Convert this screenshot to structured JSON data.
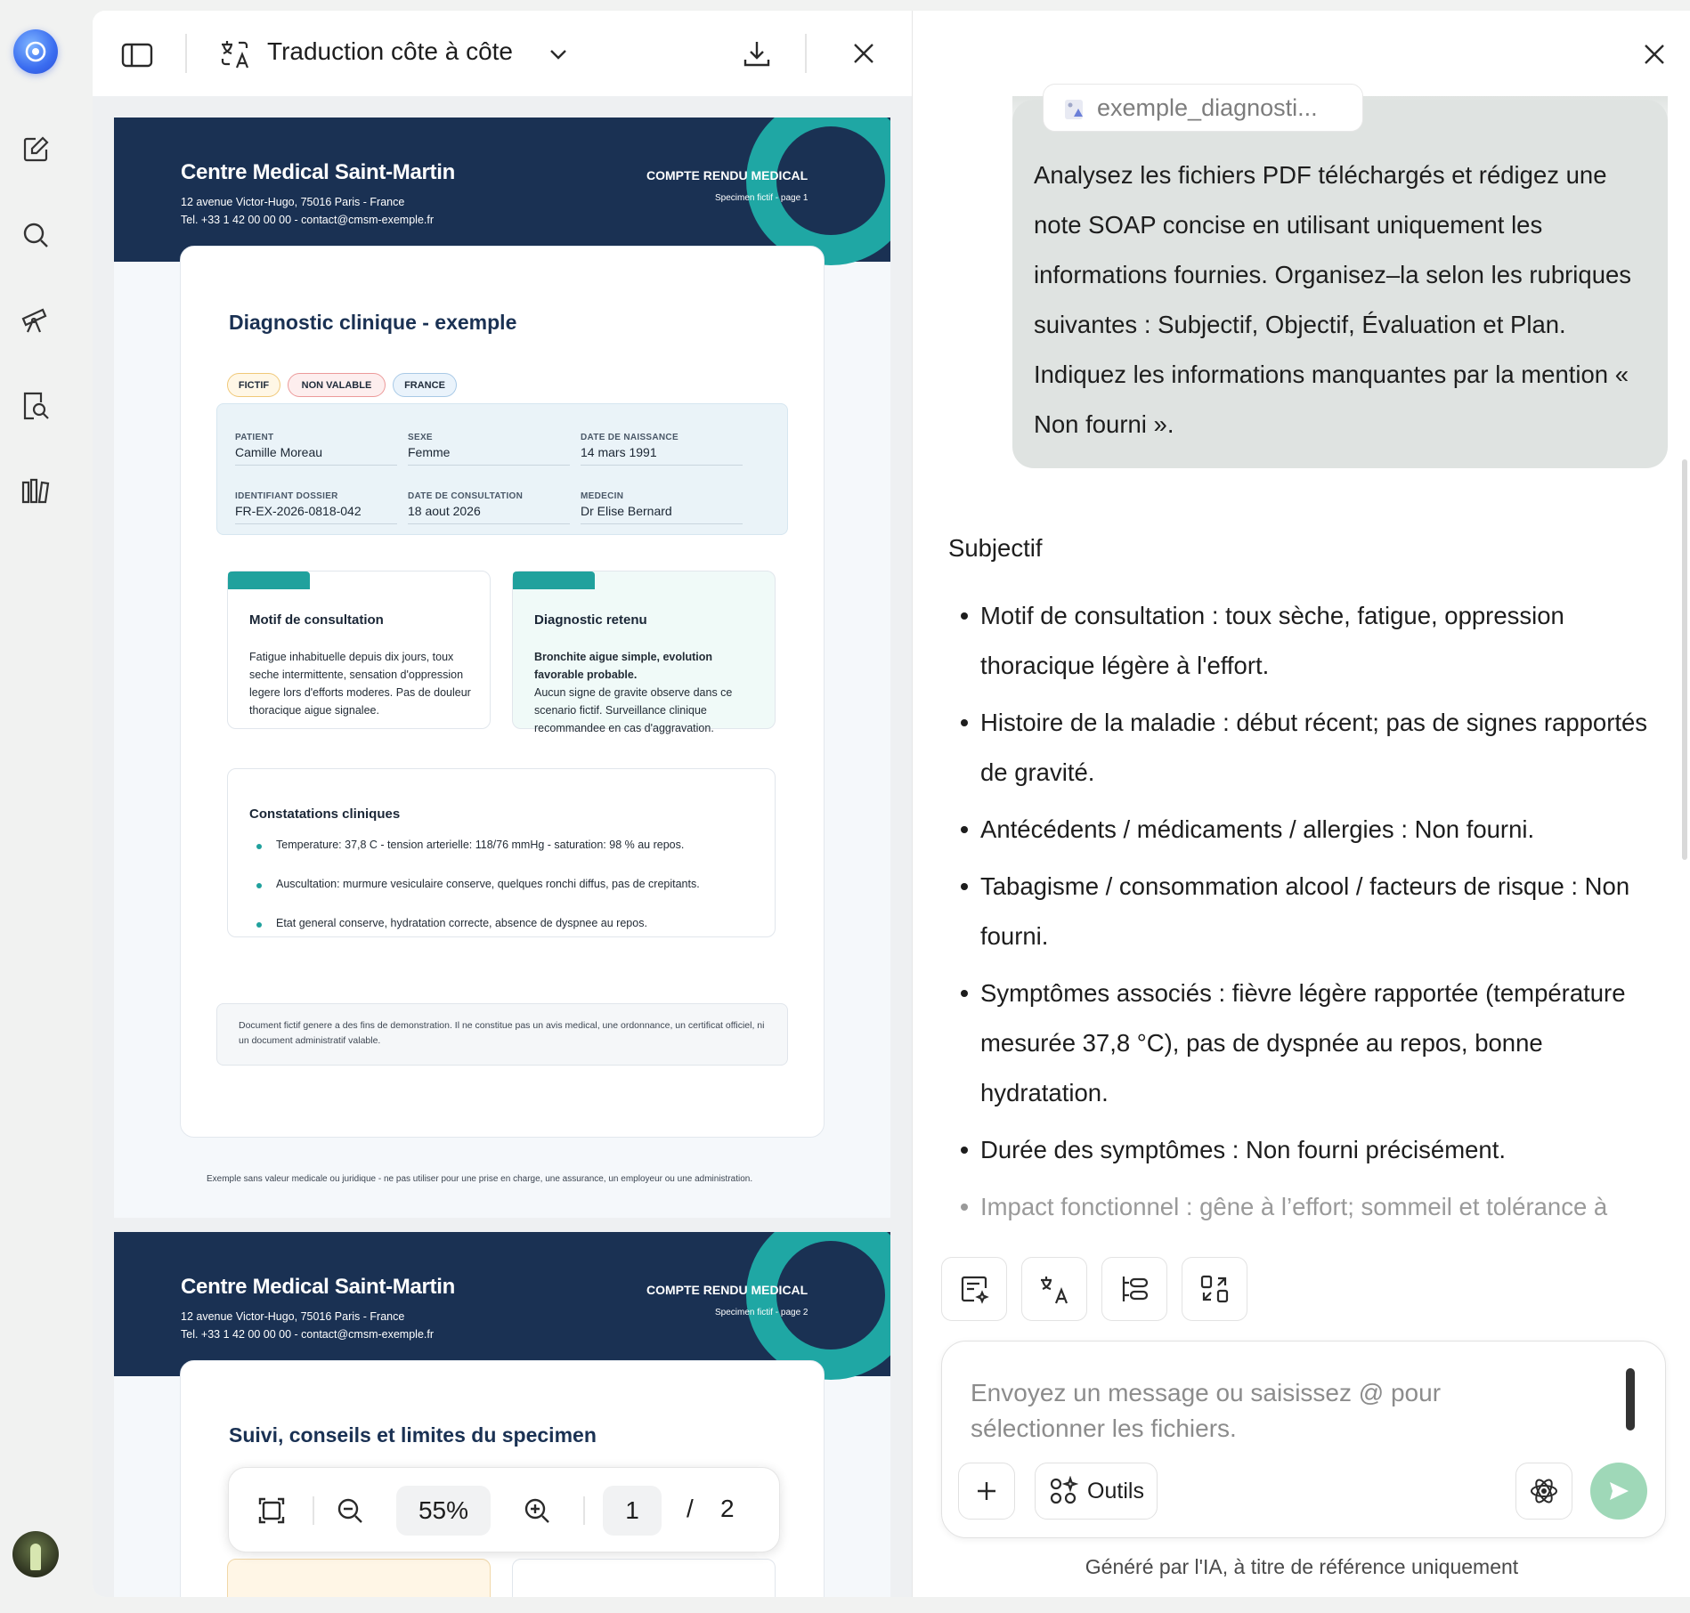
{
  "viewer": {
    "title": "Traduction côte à côte",
    "zoom": "55%",
    "page_current": "1",
    "page_sep": "/",
    "page_total": "2"
  },
  "pdf": {
    "clinic_name": "Centre Medical Saint-Martin",
    "address": "12 avenue Victor-Hugo, 75016 Paris - France",
    "contact": "Tel. +33 1 42 00 00 00 - contact@cmsm-exemple.fr",
    "header_right": "COMPTE RENDU MEDICAL",
    "specimen_p1": "Specimen fictif - page 1",
    "specimen_p2": "Specimen fictif - page 2",
    "doc_title": "Diagnostic clinique - exemple",
    "tags": [
      "FICTIF",
      "NON VALABLE",
      "FRANCE"
    ],
    "info": {
      "patient_label": "PATIENT",
      "patient": "Camille Moreau",
      "sexe_label": "SEXE",
      "sexe": "Femme",
      "dob_label": "DATE DE NAISSANCE",
      "dob": "14 mars 1991",
      "id_label": "IDENTIFIANT DOSSIER",
      "id": "FR-EX-2026-0818-042",
      "consult_label": "DATE DE CONSULTATION",
      "consult": "18 aout 2026",
      "medecin_label": "MEDECIN",
      "medecin": "Dr Elise Bernard"
    },
    "motif_title": "Motif de consultation",
    "motif_text": "Fatigue inhabituelle depuis dix jours, toux seche intermittente, sensation d'oppression legere lors d'efforts moderes. Pas de douleur thoracique aigue signalee.",
    "diag_title": "Diagnostic retenu",
    "diag_bold": "Bronchite aigue simple, evolution favorable probable.",
    "diag_text": "Aucun signe de gravite observe dans ce scenario fictif. Surveillance clinique recommandee en cas d'aggravation.",
    "constat_title": "Constatations cliniques",
    "constat_items": [
      "Temperature: 37,8 C - tension arterielle: 118/76 mmHg - saturation: 98 % au repos.",
      "Auscultation: murmure vesiculaire conserve, quelques ronchi diffus, pas de crepitants.",
      "Etat general conserve, hydratation correcte, absence de dyspnee au repos."
    ],
    "footer_note": "Document fictif genere a des fins de demonstration. Il ne constitue pas un avis medical, une ordonnance, un certificat officiel, ni un document administratif valable.",
    "page_footer": "Exemple sans valeur medicale ou juridique - ne pas utiliser pour une prise en charge, une assurance, un employeur ou une administration.",
    "page2_title": "Suivi, conseils et limites du specimen"
  },
  "chat": {
    "file_chip": "exemple_diagnosti...",
    "user_message": "Analysez les fichiers PDF téléchargés et rédigez une note SOAP concise en utilisant uniquement les informations fournies. Organisez–la selon les rubriques suivantes : Subjectif, Objectif, Évaluation et Plan. Indiquez les informations manquantes par la mention « Non fourni ».",
    "section": "Subjectif",
    "bullets": [
      "Motif de consultation : toux sèche, fatigue, oppression thoracique légère à l'effort.",
      "Histoire de la maladie : début récent; pas de signes rapportés de gravité.",
      "Antécédents / médicaments / allergies : Non fourni.",
      "Tabagisme / consommation alcool / facteurs de risque : Non fourni.",
      "Symptômes associés : fièvre légère rapportée (température mesurée 37,8 °C), pas de dyspnée au repos, bonne hydratation.",
      "Durée des symptômes : Non fourni précisément.",
      "Impact fonctionnel : gêne à l’effort; sommeil et tolérance à"
    ],
    "input_placeholder": "Envoyez un message ou saisissez @ pour sélectionner les fichiers.",
    "tools_label": "Outils",
    "disclaimer": "Généré par l'IA, à titre de référence uniquement"
  }
}
